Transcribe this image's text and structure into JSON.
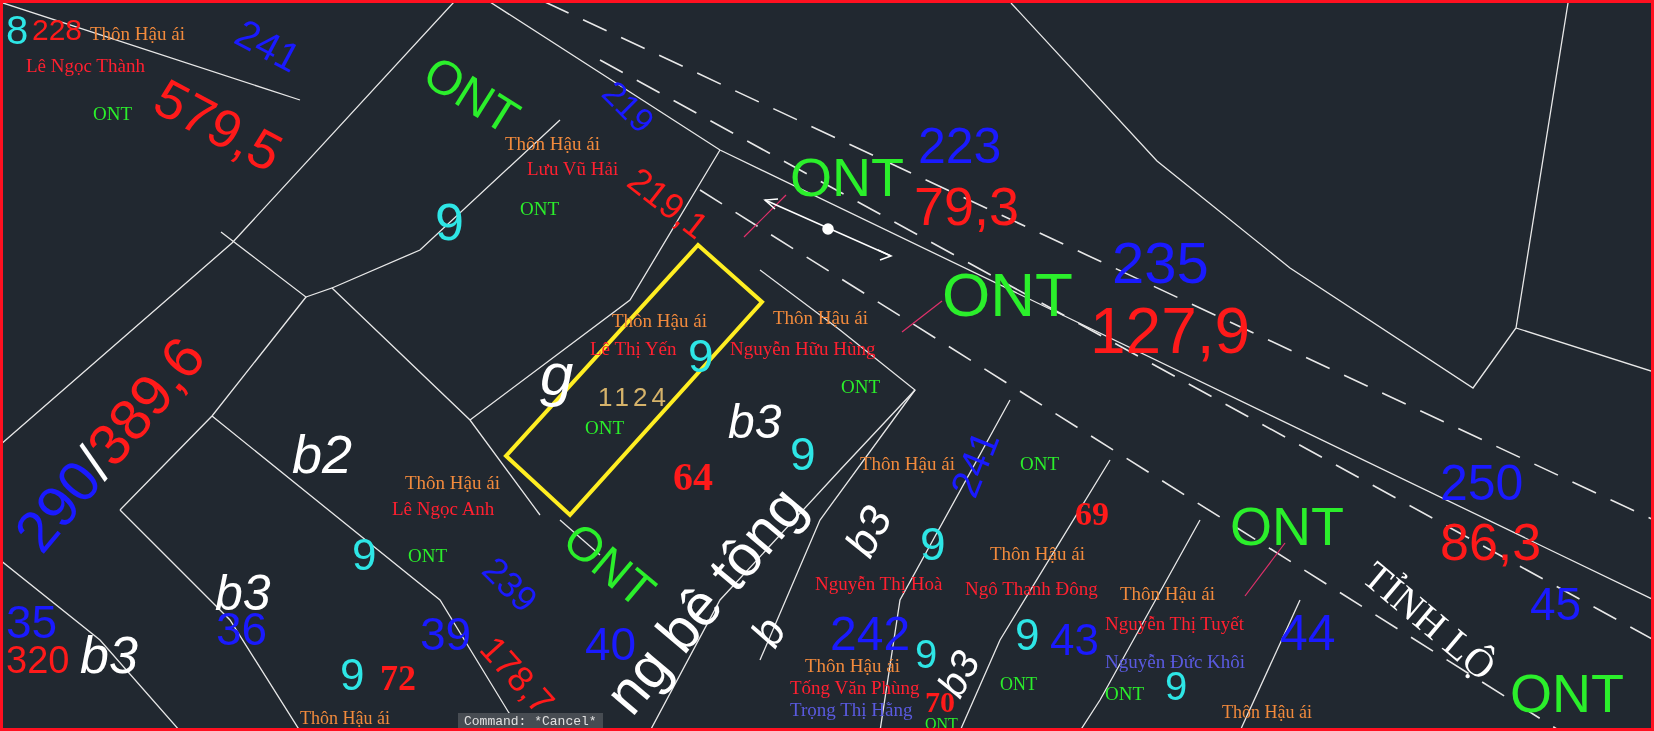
{
  "labels": [
    {
      "kind": "marker",
      "text": "8"
    },
    {
      "kind": "area",
      "text": "228"
    },
    {
      "kind": "village",
      "text": "Thôn Hậu ái"
    },
    {
      "kind": "parcel",
      "text": "241"
    },
    {
      "kind": "owner",
      "text": "Lê Ngọc Thành"
    },
    {
      "kind": "area",
      "text": "579,5"
    },
    {
      "kind": "landuse_small",
      "text": "ONT"
    },
    {
      "kind": "landuse",
      "text": "ONT"
    },
    {
      "kind": "village",
      "text": "Thôn Hậu ái"
    },
    {
      "kind": "parcel",
      "text": "219"
    },
    {
      "kind": "owner",
      "text": "Lưu Vũ Hải"
    },
    {
      "kind": "area",
      "text": "219,1"
    },
    {
      "kind": "marker",
      "text": "9"
    },
    {
      "kind": "landuse_small",
      "text": "ONT"
    },
    {
      "kind": "landuse",
      "text": "ONT"
    },
    {
      "kind": "parcel",
      "text": "223"
    },
    {
      "kind": "area",
      "text": "79,3"
    },
    {
      "kind": "village",
      "text": "Thôn Hậu ái"
    },
    {
      "kind": "owner",
      "text": "Lê Thị Yến"
    },
    {
      "kind": "marker",
      "text": "9"
    },
    {
      "kind": "block",
      "text": "g"
    },
    {
      "kind": "plot_number",
      "text": "1124"
    },
    {
      "kind": "landuse_small",
      "text": "ONT"
    },
    {
      "kind": "village",
      "text": "Thôn Hậu ái"
    },
    {
      "kind": "owner",
      "text": "Nguyễn Hữu Hùng"
    },
    {
      "kind": "landuse",
      "text": "ONT"
    },
    {
      "kind": "parcel",
      "text": "235"
    },
    {
      "kind": "area",
      "text": "127,9"
    },
    {
      "kind": "landuse_small",
      "text": "ONT"
    },
    {
      "kind": "block",
      "text": "b3"
    },
    {
      "kind": "marker",
      "text": "9"
    },
    {
      "kind": "parcel_no",
      "text": "64"
    },
    {
      "kind": "fraction",
      "number": "290",
      "separator": "/",
      "area": "389,6"
    },
    {
      "kind": "block",
      "text": "b2"
    },
    {
      "kind": "village",
      "text": "Thôn Hậu ái"
    },
    {
      "kind": "owner",
      "text": "Lê Ngọc Anh"
    },
    {
      "kind": "marker",
      "text": "9"
    },
    {
      "kind": "landuse_small",
      "text": "ONT"
    },
    {
      "kind": "landuse",
      "text": "ONT"
    },
    {
      "kind": "parcel",
      "text": "35"
    },
    {
      "kind": "block",
      "text": "b3"
    },
    {
      "kind": "parcel",
      "text": "36"
    },
    {
      "kind": "area",
      "text": "320"
    },
    {
      "kind": "block",
      "text": "b3"
    },
    {
      "kind": "parcel",
      "text": "39"
    },
    {
      "kind": "parcel",
      "text": "239"
    },
    {
      "kind": "area",
      "text": "178,7"
    },
    {
      "kind": "marker",
      "text": "9"
    },
    {
      "kind": "parcel_no",
      "text": "72"
    },
    {
      "kind": "village",
      "text": "Thôn Hậu ái"
    },
    {
      "kind": "parcel",
      "text": "40"
    },
    {
      "kind": "road",
      "text": "ng bê tông"
    },
    {
      "kind": "village",
      "text": "Thôn Hậu ái"
    },
    {
      "kind": "parcel",
      "text": "241"
    },
    {
      "kind": "landuse_small",
      "text": "ONT"
    },
    {
      "kind": "parcel_no",
      "text": "69"
    },
    {
      "kind": "block",
      "text": "b3"
    },
    {
      "kind": "marker",
      "text": "9"
    },
    {
      "kind": "owner",
      "text": "Nguyễn Thị Hoà"
    },
    {
      "kind": "village",
      "text": "Thôn Hậu ái"
    },
    {
      "kind": "owner",
      "text": "Ngô Thanh Đông"
    },
    {
      "kind": "marker",
      "text": "9"
    },
    {
      "kind": "parcel",
      "text": "43"
    },
    {
      "kind": "block",
      "text": "b3"
    },
    {
      "kind": "landuse_small",
      "text": "ONT"
    },
    {
      "kind": "parcel",
      "text": "242"
    },
    {
      "kind": "block",
      "text": "b"
    },
    {
      "kind": "village",
      "text": "Thôn Hậu ái"
    },
    {
      "kind": "owner",
      "text": "Tống Văn Phùng"
    },
    {
      "kind": "owner_dark",
      "text": "Trọng Thị Hằng"
    },
    {
      "kind": "marker",
      "text": "9"
    },
    {
      "kind": "parcel_no",
      "text": "70"
    },
    {
      "kind": "landuse_small",
      "text": "ONT"
    },
    {
      "kind": "village",
      "text": "Thôn Hậu ái"
    },
    {
      "kind": "owner",
      "text": "Nguyễn Thị Tuyết"
    },
    {
      "kind": "owner_dark",
      "text": "Nguyễn Đức Khôi"
    },
    {
      "kind": "landuse_small",
      "text": "ONT"
    },
    {
      "kind": "marker",
      "text": "9"
    },
    {
      "kind": "landuse",
      "text": "ONT"
    },
    {
      "kind": "parcel",
      "text": "250"
    },
    {
      "kind": "area",
      "text": "86,3"
    },
    {
      "kind": "road_name",
      "text": "TỈNH LỘ"
    },
    {
      "kind": "parcel",
      "text": "44"
    },
    {
      "kind": "parcel",
      "text": "45"
    },
    {
      "kind": "landuse",
      "text": "ONT"
    },
    {
      "kind": "village",
      "text": "Thôn Hậu ái"
    }
  ],
  "command_line": "Command: *Cancel*"
}
